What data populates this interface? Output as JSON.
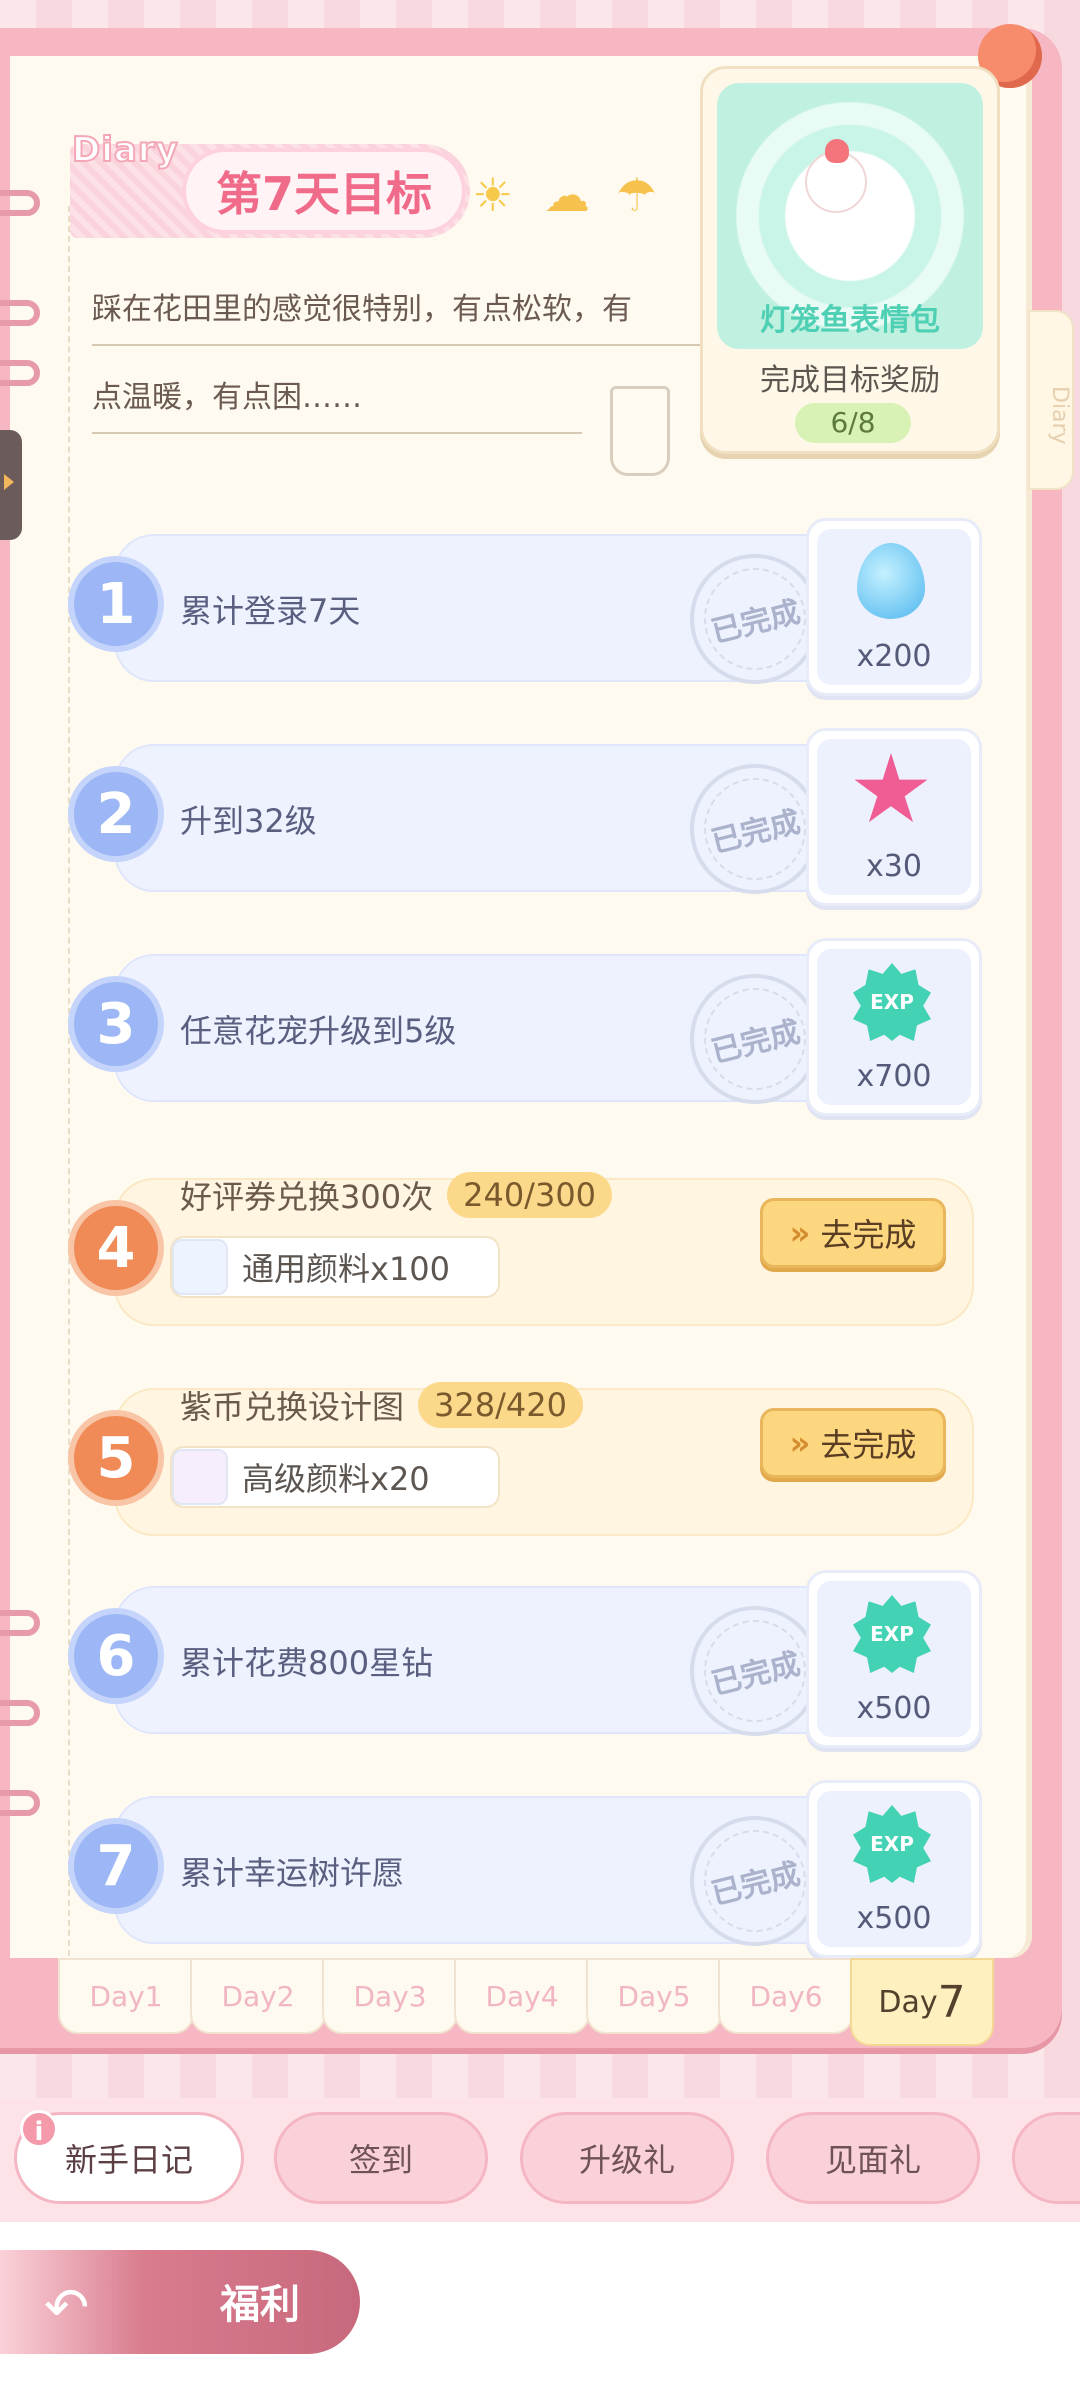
{
  "header": {
    "diary_label": "Diary",
    "title": "第7天目标",
    "intro_line1": "踩在花田里的感觉很特别，有点松软，有",
    "intro_line2": "点温暖，有点困……",
    "side_tab": "Diary"
  },
  "reward": {
    "name": "灯笼鱼表情包",
    "subtitle": "完成目标奖励",
    "progress": "6/8"
  },
  "stamp_text": "已完成",
  "tasks": [
    {
      "num": "1",
      "label": "累计登录7天",
      "reward_icon": "water-drop-icon",
      "count": "x200"
    },
    {
      "num": "2",
      "label": "升到32级",
      "reward_icon": "pink-star-icon",
      "count": "x30"
    },
    {
      "num": "3",
      "label": "任意花宠升级到5级",
      "reward_icon": "exp-badge-icon",
      "count": "x700"
    },
    {
      "num": "4",
      "label": "好评券兑换300次",
      "progress": "240/300",
      "material": "通用颜料x100",
      "button": "去完成"
    },
    {
      "num": "5",
      "label": "紫币兑换设计图",
      "progress": "328/420",
      "material": "高级颜料x20",
      "button": "去完成"
    },
    {
      "num": "6",
      "label": "累计花费800星钻",
      "reward_icon": "exp-badge-icon",
      "count": "x500"
    },
    {
      "num": "7",
      "label": "累计幸运树许愿",
      "reward_icon": "exp-badge-icon",
      "count": "x500"
    }
  ],
  "exp_text": "EXP",
  "days": [
    "Day1",
    "Day2",
    "Day3",
    "Day4",
    "Day5",
    "Day6"
  ],
  "active_day": {
    "prefix": "Day",
    "num": "7"
  },
  "nav": {
    "items": [
      "新手日记",
      "签到",
      "升级礼",
      "见面礼"
    ],
    "info": "i"
  },
  "footer": {
    "welfare": "福利"
  },
  "colors": {
    "accent_pink": "#f06b8a",
    "task_blue": "#9db6f5",
    "task_orange": "#f08a57",
    "button_yellow": "#fcd77f"
  }
}
